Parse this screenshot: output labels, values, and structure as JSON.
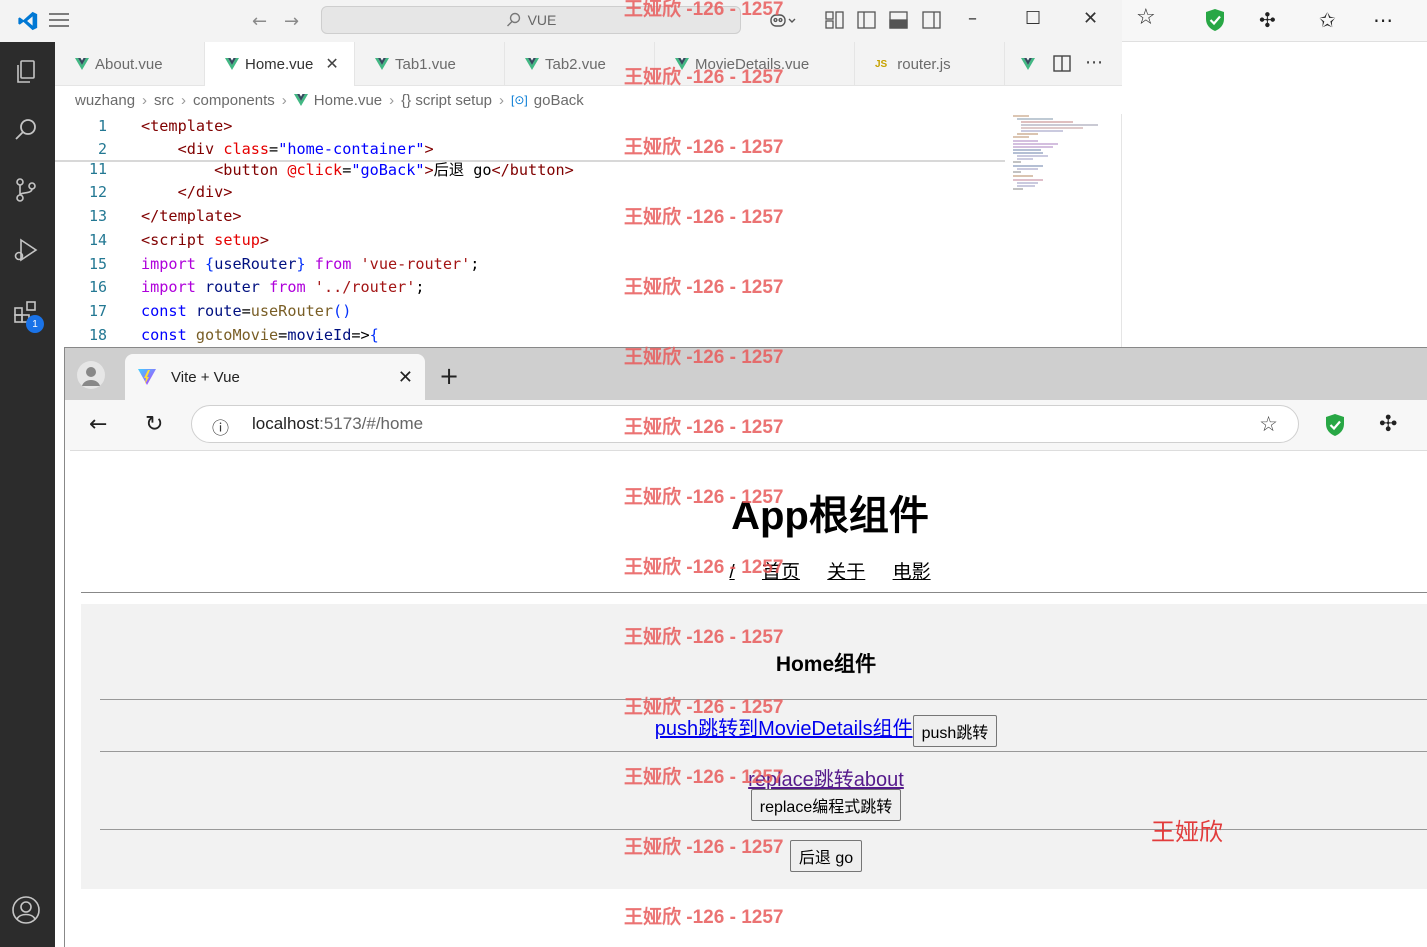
{
  "vscode": {
    "search_text": "VUE",
    "tabs": [
      {
        "label": "About.vue",
        "type": "vue"
      },
      {
        "label": "Home.vue",
        "type": "vue",
        "active": true
      },
      {
        "label": "Tab1.vue",
        "type": "vue"
      },
      {
        "label": "Tab2.vue",
        "type": "vue"
      },
      {
        "label": "MovieDetails.vue",
        "type": "vue"
      },
      {
        "label": "router.js",
        "type": "js"
      }
    ],
    "breadcrumb": [
      "wuzhang",
      "src",
      "components",
      "Home.vue",
      "{} script setup",
      "goBack"
    ],
    "extensions_badge": "1",
    "code_lines": [
      {
        "num": "1",
        "text": "<template>"
      },
      {
        "num": "2",
        "text": "    <div class=\"home-container\">"
      },
      {
        "num": "11",
        "text": "        <button @click=\"goBack\">后退 go</button>"
      },
      {
        "num": "12",
        "text": "    </div>"
      },
      {
        "num": "13",
        "text": "</template>"
      },
      {
        "num": "14",
        "text": "<script setup>"
      },
      {
        "num": "15",
        "text": "import {useRouter} from 'vue-router';"
      },
      {
        "num": "16",
        "text": "import router from '../router';"
      },
      {
        "num": "17",
        "text": "const route=useRouter()"
      },
      {
        "num": "18",
        "text": "const gotoMovie=movieId=>{"
      }
    ]
  },
  "browser": {
    "tab_title": "Vite + Vue",
    "url_host": "localhost",
    "url_rest": ":5173/#/home",
    "page": {
      "app_title": "App根组件",
      "nav_links": [
        "/",
        "首页",
        "关于",
        "电影"
      ],
      "home_title": "Home组件",
      "push_link": "push跳转到MovieDetails组件",
      "push_button": "push跳转",
      "replace_link": "replace跳转about",
      "replace_button": "replace编程式跳转",
      "back_button": "后退 go"
    }
  },
  "watermark": {
    "text": "王娅欣 -126 - 1257",
    "signature": "王娅欣"
  },
  "colors": {
    "vue_green": "#42b883",
    "vscode_blue": "#0078d4",
    "edge_shield_green": "#28a745",
    "watermark_red": "#e85a5a"
  }
}
